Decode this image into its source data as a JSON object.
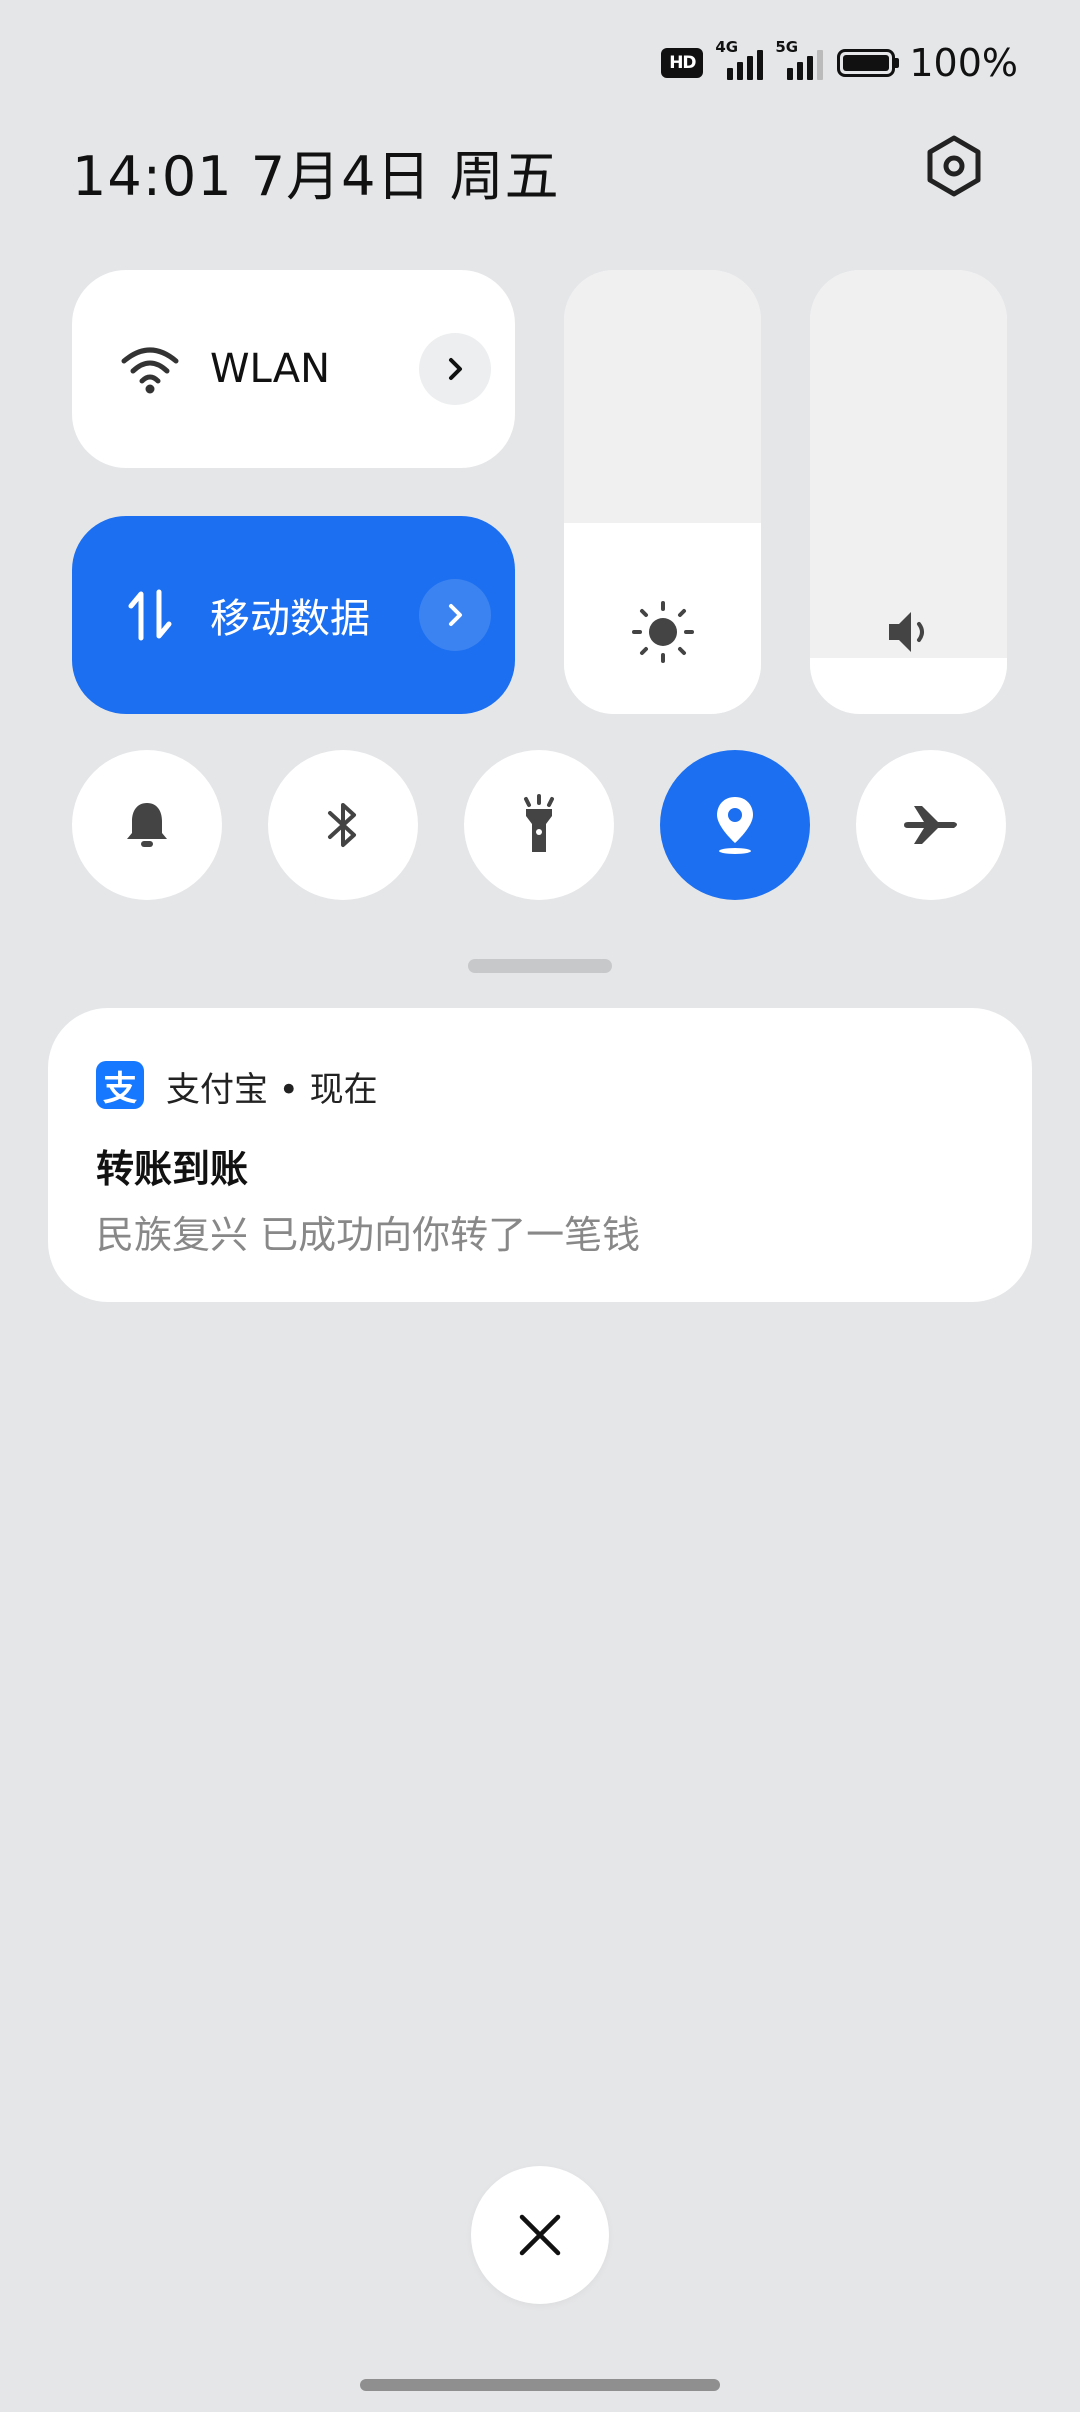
{
  "status_bar": {
    "hd_label": "HD",
    "net_4g": "4G",
    "net_5g": "5G",
    "battery_percent": "100%"
  },
  "header": {
    "datetime": "14:01  7月4日 周五"
  },
  "quick_tiles": {
    "wlan": {
      "label": "WLAN"
    },
    "mobile_data": {
      "label": "移动数据"
    }
  },
  "sliders": {
    "brightness_level": 0.43,
    "volume_level": 0.125
  },
  "toggles": [
    {
      "name": "do-not-disturb",
      "icon": "bell-icon",
      "active": false
    },
    {
      "name": "bluetooth",
      "icon": "bluetooth-icon",
      "active": false
    },
    {
      "name": "flashlight",
      "icon": "flashlight-icon",
      "active": false
    },
    {
      "name": "location",
      "icon": "location-pin-icon",
      "active": true
    },
    {
      "name": "airplane-mode",
      "icon": "airplane-icon",
      "active": false
    }
  ],
  "notification": {
    "app_icon_glyph": "支",
    "app_name_time": "支付宝 • 现在",
    "title": "转账到账",
    "body": "民族复兴 已成功向你转了一笔钱"
  },
  "colors": {
    "accent": "#1c6ff0",
    "background": "#e5e6e8",
    "tile": "#ffffff",
    "app_icon": "#1677ff"
  }
}
